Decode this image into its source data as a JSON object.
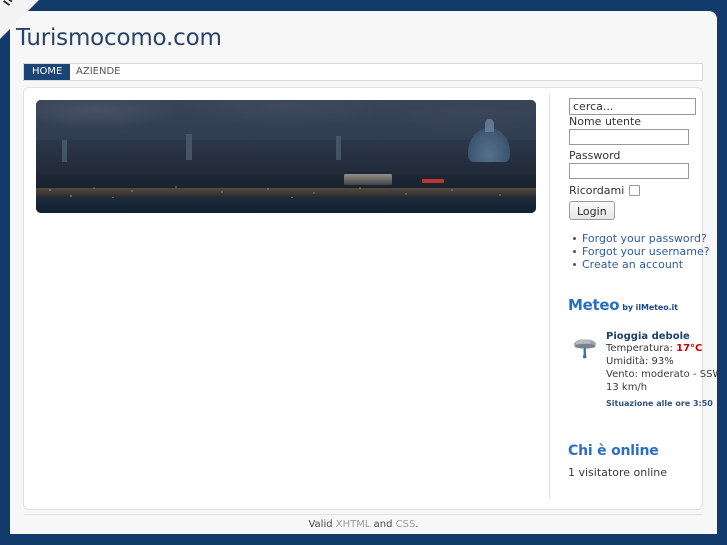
{
  "window": {
    "background_color": "#123a6b",
    "page_background": "#f7f7f7"
  },
  "corner_ribbon": {
    "text": "INF",
    "name": "corner-ribbon"
  },
  "header": {
    "site_title": "Turismocomo.com",
    "title_color": "#26436c"
  },
  "menu": {
    "items": [
      {
        "label": "HOME",
        "active": true
      },
      {
        "label": "AZIENDE",
        "active": false
      }
    ],
    "active_background": "#1b4477"
  },
  "main": {
    "banner": {
      "alt": "Panorama notturno della citta di Como con il Duomo e il lungolago"
    }
  },
  "sidebar": {
    "search": {
      "value": "cerca...",
      "placeholder": "cerca..."
    },
    "login": {
      "username_label": "Nome utente",
      "username_value": "",
      "password_label": "Password",
      "password_value": "",
      "remember_label": "Ricordami",
      "remember_checked": false,
      "submit_label": "Login"
    },
    "account_links": [
      "Forgot your password?",
      "Forgot your username?",
      "Create an account"
    ],
    "meteo": {
      "heading": "Meteo",
      "credit": "by ilMeteo.it",
      "condition": "Pioggia debole",
      "temperature_label": "Temperatura:",
      "temperature_value": "17°C",
      "humidity_line": "Umidità: 93%",
      "wind_line": "Vento: moderato - SSW",
      "wind_speed_line": "13 km/h",
      "observed_at": "Situazione alle ore 3:50",
      "icon": "cloud-rain-icon",
      "accent_color": "#2a6fc4",
      "temp_color": "#cc0000"
    },
    "online": {
      "heading": "Chi è online",
      "count_text": "1 visitatore online"
    }
  },
  "footer": {
    "valid_text": "Valid",
    "xhtml_label": "XHTML",
    "and_text": "and",
    "css_label": "CSS",
    "period": "."
  }
}
